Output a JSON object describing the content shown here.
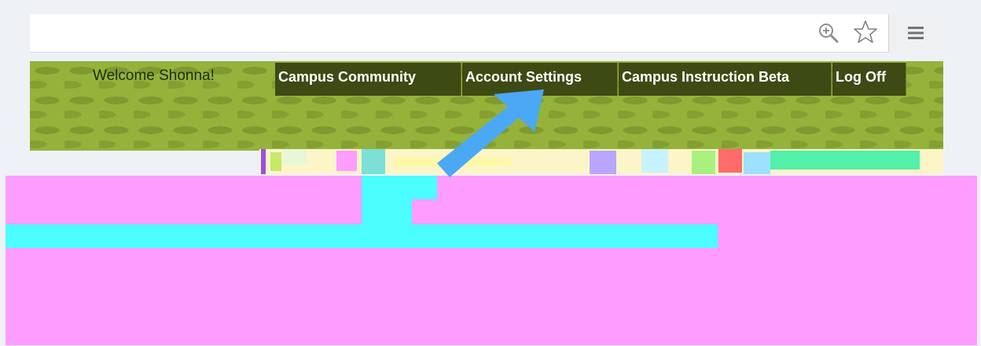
{
  "browser": {
    "zoom_icon": "zoom-in-icon",
    "star_icon": "star-icon",
    "menu_icon": "hamburger-menu-icon"
  },
  "header": {
    "welcome_text": "Welcome Shonna!",
    "nav": [
      {
        "label": "Campus Community"
      },
      {
        "label": "Account Settings"
      },
      {
        "label": "Campus Instruction Beta"
      },
      {
        "label": "Log Off"
      }
    ]
  },
  "colors": {
    "banner": "#95b23a",
    "nav_bg": "#3e4a13",
    "arrow": "#4aa8f5",
    "glitch_pink": "#ff9cff",
    "glitch_cyan": "#4bfdfd"
  }
}
